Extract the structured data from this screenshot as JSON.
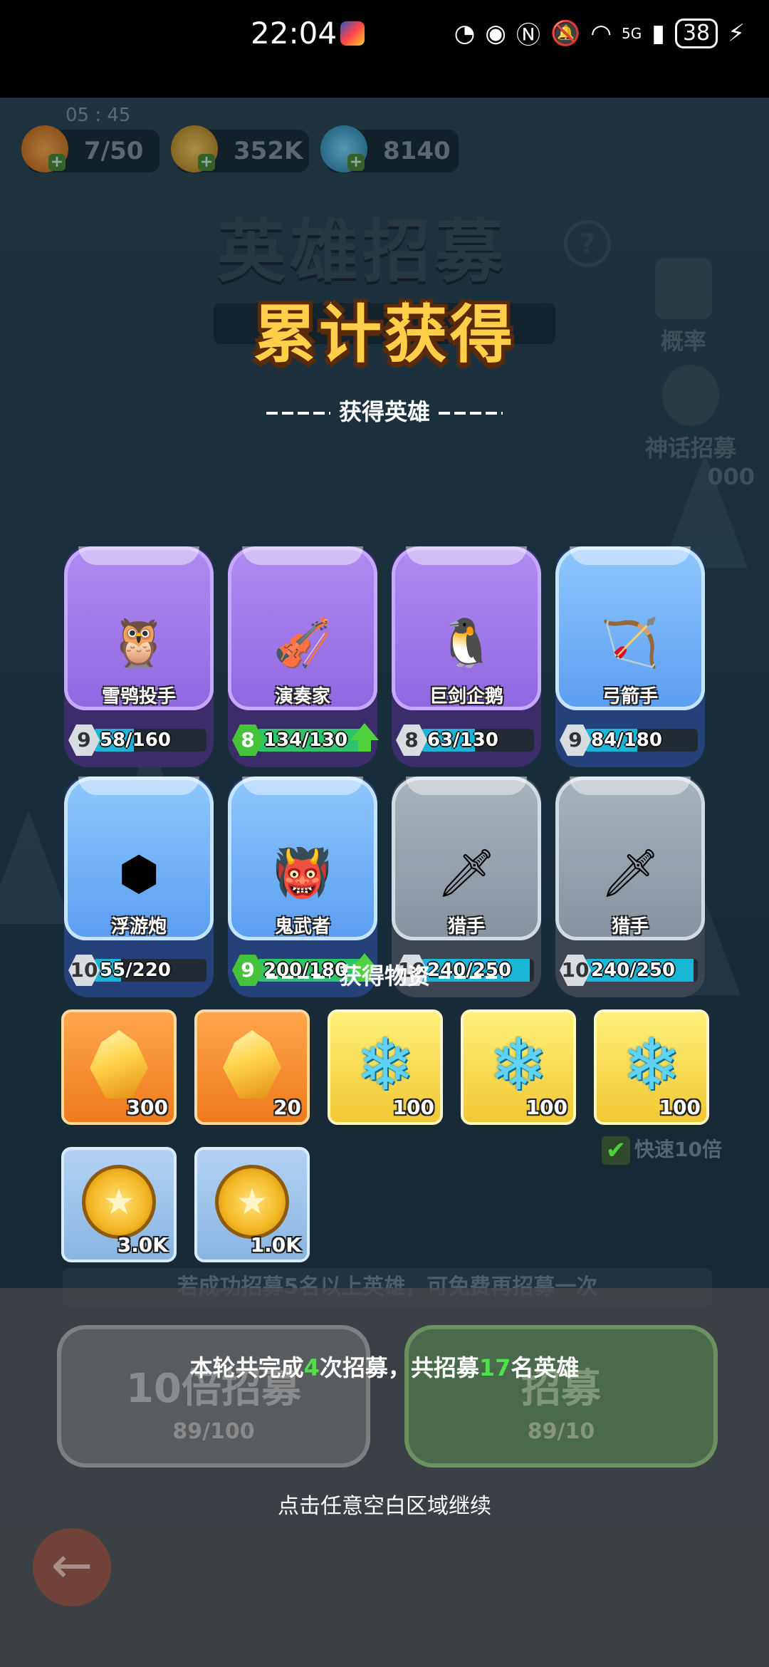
{
  "status_bar": {
    "time": "22:04",
    "battery": "38",
    "network": "5G"
  },
  "resources": {
    "timer": "05 : 45",
    "energy": "7/50",
    "gold": "352K",
    "crystal": "8140"
  },
  "background": {
    "title": "英雄招募",
    "side_probability": "概率",
    "side_mythic": "神话招募",
    "side_mythic_cost": "000",
    "hint": "若成功招募5名以上英雄，可免费再招募一次",
    "quick_label": "快速10倍",
    "btn_left_title": "10倍招募",
    "btn_left_count": "89/100",
    "btn_right_title": "招募",
    "btn_right_count": "89/10"
  },
  "main_title": "累计获得",
  "heroes_section": "获得英雄",
  "items_section": "获得物资",
  "heroes": [
    {
      "name": "雪鸮投手",
      "level": "9",
      "progress": "58/160",
      "ratio": 0.36,
      "rarity": "purple",
      "icon": "owl-icon",
      "upgrade": false
    },
    {
      "name": "演奏家",
      "level": "8",
      "progress": "134/130",
      "ratio": 1.0,
      "rarity": "purple",
      "icon": "musician-icon",
      "upgrade": true
    },
    {
      "name": "巨剑企鹅",
      "level": "8",
      "progress": "63/130",
      "ratio": 0.48,
      "rarity": "purple",
      "icon": "penguin-icon",
      "upgrade": false
    },
    {
      "name": "弓箭手",
      "level": "9",
      "progress": "84/180",
      "ratio": 0.47,
      "rarity": "blue",
      "icon": "archer-icon",
      "upgrade": false
    },
    {
      "name": "浮游炮",
      "level": "10",
      "progress": "55/220",
      "ratio": 0.25,
      "rarity": "blue",
      "icon": "cannon-icon",
      "upgrade": false
    },
    {
      "name": "鬼武者",
      "level": "9",
      "progress": "200/180",
      "ratio": 1.0,
      "rarity": "blue",
      "icon": "oni-warrior-icon",
      "upgrade": true
    },
    {
      "name": "猎手",
      "level": "10",
      "progress": "240/250",
      "ratio": 0.96,
      "rarity": "gray",
      "icon": "hunter-icon",
      "upgrade": false
    },
    {
      "name": "猎手",
      "level": "10",
      "progress": "240/250",
      "ratio": 0.96,
      "rarity": "gray",
      "icon": "hunter-icon",
      "upgrade": false
    }
  ],
  "items": [
    {
      "count": "300",
      "type": "crystal",
      "bg": "orange"
    },
    {
      "count": "20",
      "type": "crystal",
      "bg": "orange"
    },
    {
      "count": "100",
      "type": "snowflake",
      "bg": "yellow"
    },
    {
      "count": "100",
      "type": "snowflake",
      "bg": "yellow"
    },
    {
      "count": "100",
      "type": "snowflake",
      "bg": "yellow"
    },
    {
      "count": "3.0K",
      "type": "coin",
      "bg": "lightblue"
    },
    {
      "count": "1.0K",
      "type": "coin",
      "bg": "lightblue"
    }
  ],
  "summary": {
    "prefix": "本轮共完成",
    "rounds": "4",
    "middle": "次招募，共招募",
    "heroes": "17",
    "suffix": "名英雄"
  },
  "continue_hint": "点击任意空白区域继续"
}
